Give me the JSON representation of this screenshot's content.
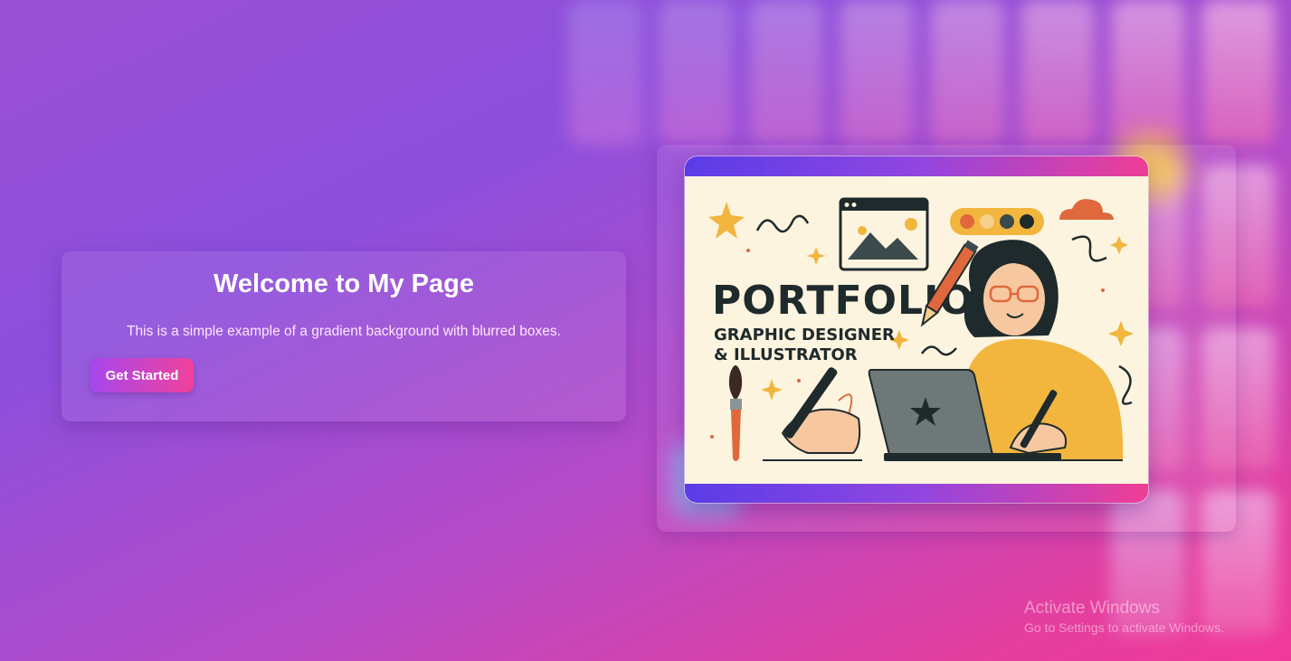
{
  "hero": {
    "title": "Welcome to My Page",
    "subtitle": "This is a simple example of a gradient background with blurred boxes.",
    "button_label": "Get Started"
  },
  "illustration": {
    "headline": "PORTFOLIO",
    "line1": "GRAPHIC DESIGNER",
    "line2": "& ILLUSTRATOR"
  },
  "watermark": {
    "title": "Activate Windows",
    "subtitle": "Go to Settings to activate Windows."
  },
  "colors": {
    "bg_start": "#9a4fd3",
    "bg_end": "#f2399b",
    "button_start": "#a747ee",
    "button_end": "#f0419b",
    "illustration_bg": "#fdf4df"
  }
}
